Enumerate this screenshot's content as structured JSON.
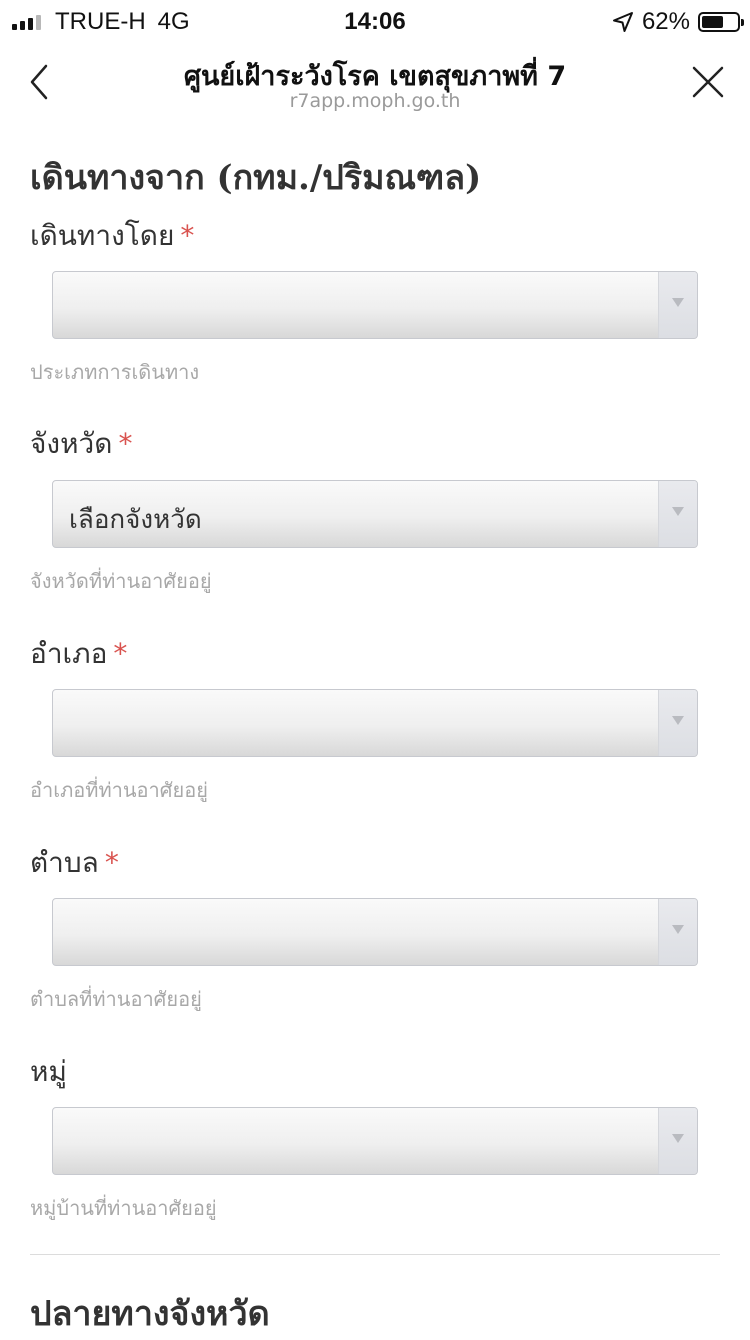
{
  "status_bar": {
    "carrier": "TRUE-H",
    "network": "4G",
    "time": "14:06",
    "battery_percent": "62%",
    "battery_level": 0.62,
    "location_icon": "location-arrow-icon"
  },
  "nav": {
    "title": "ศูนย์เฝ้าระวังโรค เขตสุขภาพที่ 7",
    "url": "r7app.moph.go.th",
    "back_icon": "chevron-left-icon",
    "close_icon": "close-icon"
  },
  "form": {
    "section_title": "เดินทางจาก (กทม./ปริมณฑล)",
    "fields": [
      {
        "label": "เดินทางโดย",
        "required_mark": "*",
        "value": "",
        "helper": "ประเภทการเดินทาง"
      },
      {
        "label": "จังหวัด",
        "required_mark": "*",
        "value": "เลือกจังหวัด",
        "helper": "จังหวัดที่ท่านอาศัยอยู่"
      },
      {
        "label": "อำเภอ",
        "required_mark": "*",
        "value": "",
        "helper": "อำเภอที่ท่านอาศัยอยู่"
      },
      {
        "label": "ตำบล",
        "required_mark": "*",
        "value": "",
        "helper": "ตำบลที่ท่านอาศัยอยู่"
      },
      {
        "label": "หมู่",
        "value": "",
        "helper": "หมู่บ้านที่ท่านอาศัยอยู่"
      }
    ],
    "next_section_title": "ปลายทางจังหวัด"
  },
  "colors": {
    "required": "#d9534f",
    "helper_text": "#a8a8a8",
    "select_border": "#c7c9cf"
  }
}
